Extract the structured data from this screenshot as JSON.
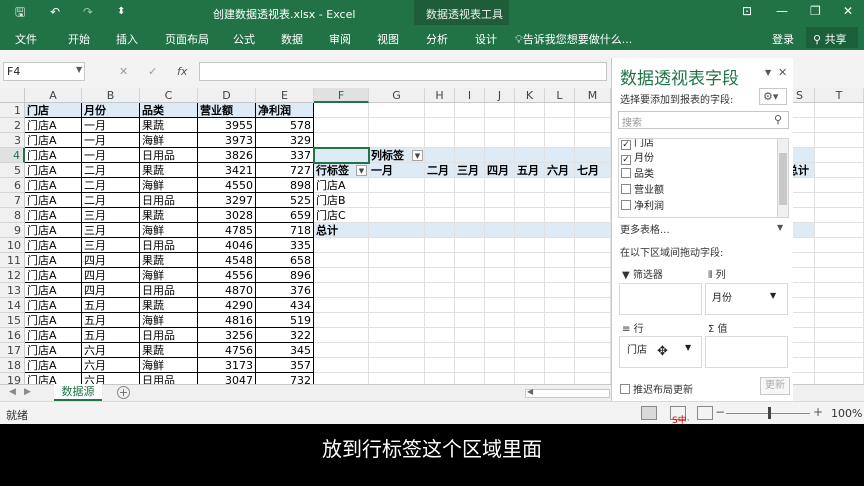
{
  "titlebar": {
    "save_icon": "save-icon",
    "undo_icon": "undo-icon",
    "redo_icon": "redo-icon",
    "doc_title": "创建数据透视表.xlsx - Excel",
    "context_title": "数据透视表工具",
    "window_buttons": [
      "ribbon-display-icon",
      "minimize-icon",
      "restore-icon",
      "close-icon"
    ]
  },
  "ribbon": {
    "tabs": [
      "文件",
      "开始",
      "插入",
      "页面布局",
      "公式",
      "数据",
      "审阅",
      "视图"
    ],
    "context_tabs": [
      "分析",
      "设计"
    ],
    "tell_me": "告诉我您想要做什么...",
    "login": "登录",
    "share": "共享"
  },
  "formula_bar": {
    "name_box": "F4",
    "cancel_symbol": "✕",
    "enter_symbol": "✓",
    "fx_symbol": "fx",
    "formula": ""
  },
  "grid": {
    "columns": [
      "A",
      "B",
      "C",
      "D",
      "E",
      "F",
      "G",
      "H",
      "I",
      "J",
      "K",
      "L",
      "M",
      "S",
      "T"
    ],
    "header_row": [
      "门店",
      "月份",
      "品类",
      "营业额",
      "净利润"
    ],
    "rows": [
      [
        "门店A",
        "一月",
        "果蔬",
        "3955",
        "578"
      ],
      [
        "门店A",
        "一月",
        "海鲜",
        "3973",
        "329"
      ],
      [
        "门店A",
        "一月",
        "日用品",
        "3826",
        "337"
      ],
      [
        "门店A",
        "二月",
        "果蔬",
        "3421",
        "727"
      ],
      [
        "门店A",
        "二月",
        "海鲜",
        "4550",
        "898"
      ],
      [
        "门店A",
        "二月",
        "日用品",
        "3297",
        "525"
      ],
      [
        "门店A",
        "三月",
        "果蔬",
        "3028",
        "659"
      ],
      [
        "门店A",
        "三月",
        "海鲜",
        "4785",
        "718"
      ],
      [
        "门店A",
        "三月",
        "日用品",
        "4046",
        "335"
      ],
      [
        "门店A",
        "四月",
        "果蔬",
        "4548",
        "658"
      ],
      [
        "门店A",
        "四月",
        "海鲜",
        "4556",
        "896"
      ],
      [
        "门店A",
        "四月",
        "日用品",
        "4870",
        "376"
      ],
      [
        "门店A",
        "五月",
        "果蔬",
        "4290",
        "434"
      ],
      [
        "门店A",
        "五月",
        "海鲜",
        "4816",
        "519"
      ],
      [
        "门店A",
        "五月",
        "日用品",
        "3256",
        "322"
      ],
      [
        "门店A",
        "六月",
        "果蔬",
        "4756",
        "345"
      ],
      [
        "门店A",
        "六月",
        "海鲜",
        "3173",
        "357"
      ],
      [
        "门店A",
        "六月",
        "日用品",
        "3047",
        "732"
      ]
    ]
  },
  "pivot": {
    "col_label": "列标签",
    "row_label": "行标签",
    "months": [
      "一月",
      "二月",
      "三月",
      "四月",
      "五月",
      "六月",
      "七月"
    ],
    "stores": [
      "门店A",
      "门店B",
      "门店C"
    ],
    "grand_total": "总计",
    "partial_total": "总计"
  },
  "sheets": {
    "active": "数据源",
    "add_icon": "plus-icon"
  },
  "status": {
    "ready": "就绪",
    "zoom": "100%"
  },
  "pane": {
    "title": "数据透视表字段",
    "choose_label": "选择要添加到报表的字段:",
    "search_placeholder": "搜索",
    "fields": [
      {
        "name": "门店",
        "checked": "✓"
      },
      {
        "name": "月份",
        "checked": "✓"
      },
      {
        "name": "品类",
        "checked": ""
      },
      {
        "name": "营业额",
        "checked": ""
      },
      {
        "name": "净利润",
        "checked": ""
      }
    ],
    "more_tables": "更多表格...",
    "drag_hint": "在以下区域间拖动字段:",
    "filters_label": "筛选器",
    "columns_label": "列",
    "columns_item": "月份",
    "rows_label": "行",
    "rows_item": "门店",
    "values_label": "值",
    "defer_label": "推迟布局更新",
    "update_button": "更新"
  },
  "subtitle": "放到行标签这个区域里面",
  "watermark": "S中·"
}
